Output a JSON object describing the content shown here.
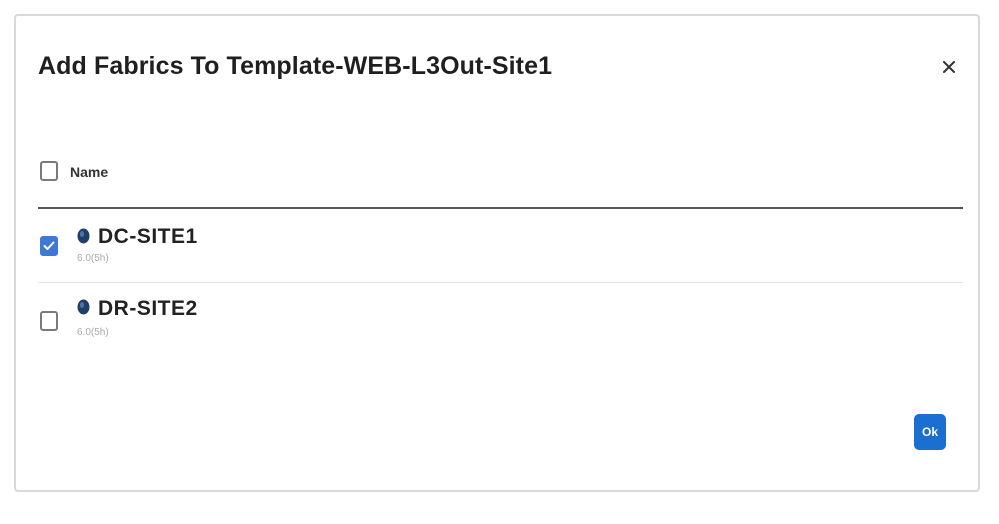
{
  "dialog": {
    "title": "Add Fabrics To Template-WEB-L3Out-Site1",
    "close_icon": "close-icon"
  },
  "table": {
    "header": {
      "name_label": "Name",
      "select_all_checked": false
    },
    "rows": [
      {
        "name": "DC-SITE1",
        "version": "6.0(5h)",
        "checked": true,
        "icon": "fabric-site-icon"
      },
      {
        "name": "DR-SITE2",
        "version": "6.0(5h)",
        "checked": false,
        "icon": "fabric-site-icon"
      }
    ]
  },
  "footer": {
    "ok_label": "Ok"
  },
  "colors": {
    "accent": "#1b6fd1",
    "checkbox_checked": "#3f78d6",
    "icon_fill": "#1f3f66"
  }
}
